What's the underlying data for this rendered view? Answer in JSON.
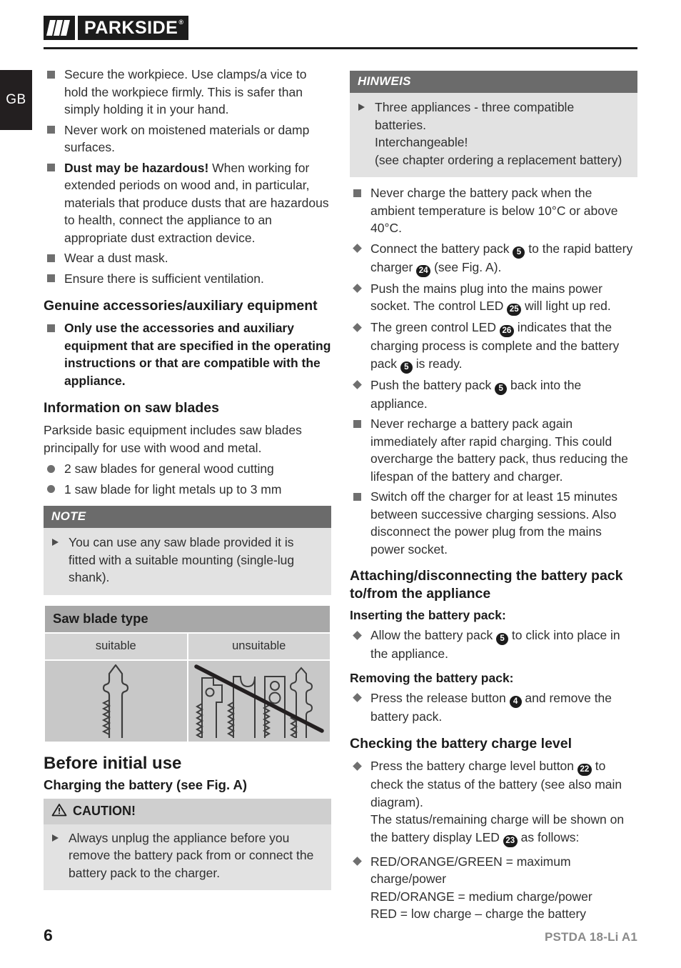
{
  "header": {
    "logo_slashes": "///",
    "logo_word": "PARKSIDE",
    "logo_reg": "®",
    "language_tab": "GB"
  },
  "left_column": {
    "safety_bullets": [
      {
        "marker": "square",
        "text": "Secure the workpiece. Use clamps/a vice to hold the workpiece firmly. This is safer than simply holding it in your hand."
      },
      {
        "marker": "square",
        "text": "Never work on moistened materials or damp surfaces."
      },
      {
        "marker": "square",
        "lead": "Dust may be hazardous!",
        "text": " When working for extended periods on wood and, in particular, materials that produce dusts that are hazardous to health, connect the appliance to an appropriate dust extraction device."
      },
      {
        "marker": "square",
        "text": "Wear a dust mask."
      },
      {
        "marker": "square",
        "text": "Ensure there is sufficient ventilation."
      }
    ],
    "heading_accessories": "Genuine accessories/auxiliary equipment",
    "accessories_bullet": "Only use the accessories and auxiliary equipment that are specified in the operating instructions or that are compatible with the appliance.",
    "heading_saw_blades": "Information on saw blades",
    "saw_blades_intro": "Parkside basic equipment includes saw blades principally for use with wood and metal.",
    "saw_blade_items": [
      "2 saw blades for general wood cutting",
      "1 saw blade for light metals up to 3 mm"
    ],
    "note_box": {
      "title": "NOTE",
      "text": "You can use any saw blade provided it is fitted with a suitable mounting (single-lug shank)."
    },
    "blade_table": {
      "title": "Saw blade type",
      "col_suitable": "suitable",
      "col_unsuitable": "unsuitable"
    },
    "heading_before_use": "Before initial use",
    "heading_charging": "Charging the battery (see Fig. A)",
    "caution_box": {
      "title": "CAUTION!",
      "icon": "warning-triangle-icon",
      "text": "Always unplug the appliance before you remove the battery pack from or connect the battery pack to the charger."
    }
  },
  "right_column": {
    "hinweis_box": {
      "title": "HINWEIS",
      "line1": "Three appliances - three compatible batteries.",
      "line2": "Interchangeable!",
      "line3": "(see chapter ordering a replacement battery)"
    },
    "charging_bullets": [
      {
        "marker": "square",
        "parts": [
          {
            "t": "Never charge the battery pack when the ambient temperature is below 10°C or above 40°C."
          }
        ]
      },
      {
        "marker": "diamond",
        "parts": [
          {
            "t": "Connect the battery pack "
          },
          {
            "n": "5"
          },
          {
            "t": " to the rapid battery charger "
          },
          {
            "n": "24"
          },
          {
            "t": " (see Fig. A)."
          }
        ]
      },
      {
        "marker": "diamond",
        "parts": [
          {
            "t": "Push the mains plug into the mains power socket. The control LED "
          },
          {
            "n": "25"
          },
          {
            "t": " will light up red."
          }
        ]
      },
      {
        "marker": "diamond",
        "parts": [
          {
            "t": "The green control LED "
          },
          {
            "n": "26"
          },
          {
            "t": " indicates that the charging process is complete and the battery pack "
          },
          {
            "n": "5"
          },
          {
            "t": " is ready."
          }
        ]
      },
      {
        "marker": "diamond",
        "parts": [
          {
            "t": "Push the battery pack "
          },
          {
            "n": "5"
          },
          {
            "t": " back into the appliance."
          }
        ]
      },
      {
        "marker": "square",
        "parts": [
          {
            "t": "Never recharge a battery pack again immediately after rapid charging. This could overcharge the battery pack, thus reducing the lifespan of the battery and charger."
          }
        ]
      },
      {
        "marker": "square",
        "parts": [
          {
            "t": "Switch off the charger for at least 15 minutes between successive charging sessions. Also disconnect the power plug from the mains power socket."
          }
        ]
      }
    ],
    "heading_attaching": "Attaching/disconnecting the battery pack to/from the appliance",
    "sub_inserting": "Inserting the battery pack:",
    "inserting_bullet": [
      {
        "t": "Allow the battery pack "
      },
      {
        "n": "5"
      },
      {
        "t": " to click into place in the appliance."
      }
    ],
    "sub_removing": "Removing the battery pack:",
    "removing_bullet": [
      {
        "t": "Press the release button "
      },
      {
        "n": "4"
      },
      {
        "t": " and remove the battery pack."
      }
    ],
    "heading_checking": "Checking the battery charge level",
    "checking_bullet": [
      {
        "t": "Press the battery charge level button "
      },
      {
        "n": "22"
      },
      {
        "t": " to check the status of the battery (see also main diagram)."
      },
      {
        "br": true
      },
      {
        "t": "The status/remaining charge will be shown on the battery display LED "
      },
      {
        "n": "23"
      },
      {
        "t": " as follows:"
      }
    ],
    "status_lines": [
      "RED/ORANGE/GREEN = maximum charge/power",
      "RED/ORANGE = medium charge/power",
      "RED = low charge – charge the battery"
    ]
  },
  "footer": {
    "page_number": "6",
    "model": "PSTDA 18-Li A1"
  },
  "colors": {
    "dark": "#1c1c1c",
    "body_text": "#2f2f2f",
    "marker_gray": "#6f6f6f",
    "note_head": "#6b6b6b",
    "note_body": "#e2e2e2",
    "table_head": "#a8a8a8",
    "table_sub": "#d4d4d4",
    "table_cell": "#c8c8c8"
  }
}
